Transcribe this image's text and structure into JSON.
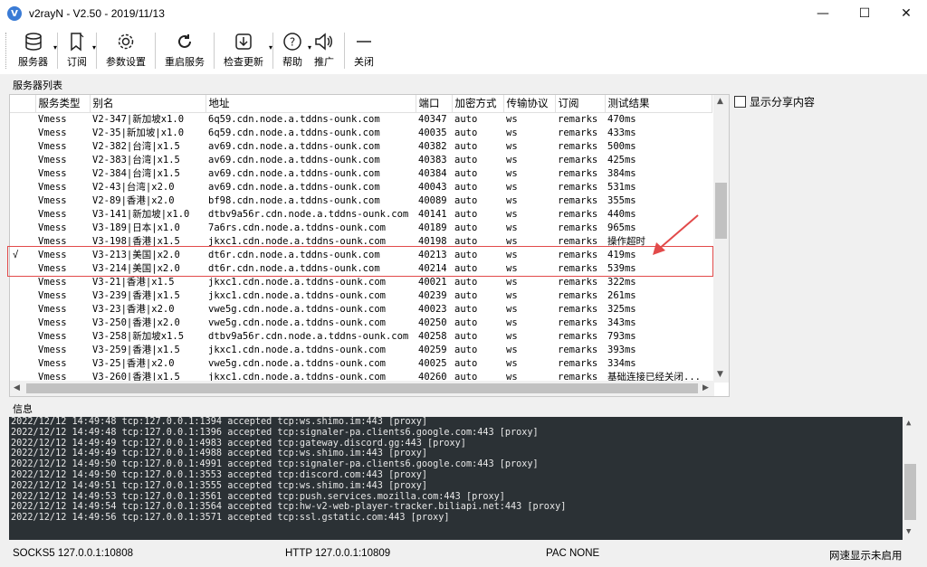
{
  "window": {
    "title": "v2rayN - V2.50 - 2019/11/13"
  },
  "toolbar": {
    "servers": "服务器",
    "subscribe": "订阅",
    "settings": "参数设置",
    "restart": "重启服务",
    "update": "检查更新",
    "help": "帮助",
    "promote": "推广",
    "close": "关闭"
  },
  "server_list": {
    "label": "服务器列表",
    "columns": [
      "服务类型",
      "别名",
      "地址",
      "端口",
      "加密方式",
      "传输协议",
      "订阅",
      "测试结果"
    ],
    "rows": [
      {
        "sel": "",
        "type": "Vmess",
        "alias": "V2-347|新加坡x1.0",
        "addr": "6q59.cdn.node.a.tddns-ounk.com",
        "port": "40347",
        "enc": "auto",
        "net": "ws",
        "sub": "remarks",
        "result": "470ms"
      },
      {
        "sel": "",
        "type": "Vmess",
        "alias": "V2-35|新加坡|x1.0",
        "addr": "6q59.cdn.node.a.tddns-ounk.com",
        "port": "40035",
        "enc": "auto",
        "net": "ws",
        "sub": "remarks",
        "result": "433ms"
      },
      {
        "sel": "",
        "type": "Vmess",
        "alias": "V2-382|台湾|x1.5",
        "addr": "av69.cdn.node.a.tddns-ounk.com",
        "port": "40382",
        "enc": "auto",
        "net": "ws",
        "sub": "remarks",
        "result": "500ms"
      },
      {
        "sel": "",
        "type": "Vmess",
        "alias": "V2-383|台湾|x1.5",
        "addr": "av69.cdn.node.a.tddns-ounk.com",
        "port": "40383",
        "enc": "auto",
        "net": "ws",
        "sub": "remarks",
        "result": "425ms"
      },
      {
        "sel": "",
        "type": "Vmess",
        "alias": "V2-384|台湾|x1.5",
        "addr": "av69.cdn.node.a.tddns-ounk.com",
        "port": "40384",
        "enc": "auto",
        "net": "ws",
        "sub": "remarks",
        "result": "384ms"
      },
      {
        "sel": "",
        "type": "Vmess",
        "alias": "V2-43|台湾|x2.0",
        "addr": "av69.cdn.node.a.tddns-ounk.com",
        "port": "40043",
        "enc": "auto",
        "net": "ws",
        "sub": "remarks",
        "result": "531ms"
      },
      {
        "sel": "",
        "type": "Vmess",
        "alias": "V2-89|香港|x2.0",
        "addr": "bf98.cdn.node.a.tddns-ounk.com",
        "port": "40089",
        "enc": "auto",
        "net": "ws",
        "sub": "remarks",
        "result": "355ms"
      },
      {
        "sel": "",
        "type": "Vmess",
        "alias": "V3-141|新加坡|x1.0",
        "addr": "dtbv9a56r.cdn.node.a.tddns-ounk.com",
        "port": "40141",
        "enc": "auto",
        "net": "ws",
        "sub": "remarks",
        "result": "440ms"
      },
      {
        "sel": "",
        "type": "Vmess",
        "alias": "V3-189|日本|x1.0",
        "addr": "7a6rs.cdn.node.a.tddns-ounk.com",
        "port": "40189",
        "enc": "auto",
        "net": "ws",
        "sub": "remarks",
        "result": "965ms"
      },
      {
        "sel": "",
        "type": "Vmess",
        "alias": "V3-198|香港|x1.5",
        "addr": "jkxc1.cdn.node.a.tddns-ounk.com",
        "port": "40198",
        "enc": "auto",
        "net": "ws",
        "sub": "remarks",
        "result": "操作超时"
      },
      {
        "sel": "√",
        "type": "Vmess",
        "alias": "V3-213|美国|x2.0",
        "addr": "dt6r.cdn.node.a.tddns-ounk.com",
        "port": "40213",
        "enc": "auto",
        "net": "ws",
        "sub": "remarks",
        "result": "419ms"
      },
      {
        "sel": "",
        "type": "Vmess",
        "alias": "V3-214|美国|x2.0",
        "addr": "dt6r.cdn.node.a.tddns-ounk.com",
        "port": "40214",
        "enc": "auto",
        "net": "ws",
        "sub": "remarks",
        "result": "539ms"
      },
      {
        "sel": "",
        "type": "Vmess",
        "alias": "V3-21|香港|x1.5",
        "addr": "jkxc1.cdn.node.a.tddns-ounk.com",
        "port": "40021",
        "enc": "auto",
        "net": "ws",
        "sub": "remarks",
        "result": "322ms"
      },
      {
        "sel": "",
        "type": "Vmess",
        "alias": "V3-239|香港|x1.5",
        "addr": "jkxc1.cdn.node.a.tddns-ounk.com",
        "port": "40239",
        "enc": "auto",
        "net": "ws",
        "sub": "remarks",
        "result": "261ms"
      },
      {
        "sel": "",
        "type": "Vmess",
        "alias": "V3-23|香港|x2.0",
        "addr": "vwe5g.cdn.node.a.tddns-ounk.com",
        "port": "40023",
        "enc": "auto",
        "net": "ws",
        "sub": "remarks",
        "result": "325ms"
      },
      {
        "sel": "",
        "type": "Vmess",
        "alias": "V3-250|香港|x2.0",
        "addr": "vwe5g.cdn.node.a.tddns-ounk.com",
        "port": "40250",
        "enc": "auto",
        "net": "ws",
        "sub": "remarks",
        "result": "343ms"
      },
      {
        "sel": "",
        "type": "Vmess",
        "alias": "V3-258|新加坡x1.5",
        "addr": "dtbv9a56r.cdn.node.a.tddns-ounk.com",
        "port": "40258",
        "enc": "auto",
        "net": "ws",
        "sub": "remarks",
        "result": "793ms"
      },
      {
        "sel": "",
        "type": "Vmess",
        "alias": "V3-259|香港|x1.5",
        "addr": "jkxc1.cdn.node.a.tddns-ounk.com",
        "port": "40259",
        "enc": "auto",
        "net": "ws",
        "sub": "remarks",
        "result": "393ms"
      },
      {
        "sel": "",
        "type": "Vmess",
        "alias": "V3-25|香港|x2.0",
        "addr": "vwe5g.cdn.node.a.tddns-ounk.com",
        "port": "40025",
        "enc": "auto",
        "net": "ws",
        "sub": "remarks",
        "result": "334ms"
      },
      {
        "sel": "",
        "type": "Vmess",
        "alias": "V3-260|香港|x1.5",
        "addr": "jkxc1.cdn.node.a.tddns-ounk.com",
        "port": "40260",
        "enc": "auto",
        "net": "ws",
        "sub": "remarks",
        "result": "基础连接已经关闭..."
      }
    ]
  },
  "show_share": {
    "label": "显示分享内容"
  },
  "info": {
    "label": "信息",
    "lines": [
      "2022/12/12 14:49:48 tcp:127.0.0.1:1394 accepted tcp:ws.shimo.im:443 [proxy]",
      "2022/12/12 14:49:48 tcp:127.0.0.1:1396 accepted tcp:signaler-pa.clients6.google.com:443 [proxy]",
      "2022/12/12 14:49:49 tcp:127.0.0.1:4983 accepted tcp:gateway.discord.gg:443 [proxy]",
      "2022/12/12 14:49:49 tcp:127.0.0.1:4988 accepted tcp:ws.shimo.im:443 [proxy]",
      "2022/12/12 14:49:50 tcp:127.0.0.1:4991 accepted tcp:signaler-pa.clients6.google.com:443 [proxy]",
      "2022/12/12 14:49:50 tcp:127.0.0.1:3553 accepted tcp:discord.com:443 [proxy]",
      "2022/12/12 14:49:51 tcp:127.0.0.1:3555 accepted tcp:ws.shimo.im:443 [proxy]",
      "2022/12/12 14:49:53 tcp:127.0.0.1:3561 accepted tcp:push.services.mozilla.com:443 [proxy]",
      "2022/12/12 14:49:54 tcp:127.0.0.1:3564 accepted tcp:hw-v2-web-player-tracker.biliapi.net:443 [proxy]",
      "2022/12/12 14:49:56 tcp:127.0.0.1:3571 accepted tcp:ssl.gstatic.com:443 [proxy]"
    ]
  },
  "status": {
    "socks": "SOCKS5  127.0.0.1:10808",
    "http": "HTTP  127.0.0.1:10809",
    "pac": "PAC  NONE",
    "speed": "网速显示未启用"
  },
  "colors": {
    "highlight": "#e24a4a",
    "log_bg": "#2b3135",
    "app_icon": "#3a7bd5"
  }
}
